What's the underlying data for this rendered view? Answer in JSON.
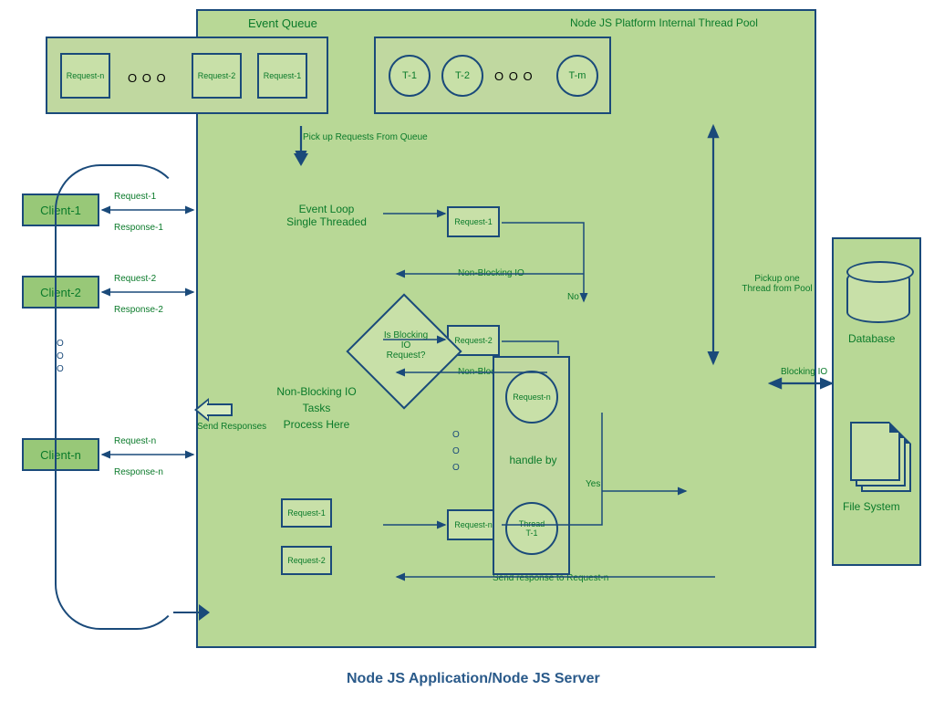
{
  "title": "Node JS Application/Node JS Server",
  "clients": {
    "items": [
      "Client-1",
      "Client-2",
      "Client-n"
    ],
    "requests": [
      "Request-1",
      "Request-2",
      "Request-n"
    ],
    "responses": [
      "Response-1",
      "Response-2",
      "Response-n"
    ]
  },
  "event_queue": {
    "title": "Event Queue",
    "slots": [
      "Request-n",
      "Request-2",
      "Request-1"
    ],
    "ellipsis": "O O O",
    "pickup_label": "Pick up Requests From Queue"
  },
  "thread_pool": {
    "title": "Node JS Platform Internal Thread Pool",
    "threads": [
      "T-1",
      "T-2",
      "T-m"
    ],
    "ellipsis": "O O O",
    "pickup_label": "Pickup one Thread from Pool"
  },
  "event_loop": {
    "title_line1": "Event Loop",
    "title_line2": "Single Threaded",
    "nb_title_line1": "Non-Blocking IO",
    "nb_title_line2": "Tasks",
    "nb_title_line3": "Process Here",
    "inner_requests": [
      "Request-1",
      "Request-2"
    ]
  },
  "flow": {
    "req_boxes": [
      "Request-1",
      "Request-2",
      "Request-n"
    ],
    "non_blocking_label": "Non-Blocking IO",
    "no_label": "No",
    "yes_label": "Yes",
    "send_response_label": "Send response to Request-n",
    "send_responses_label": "Send Responses"
  },
  "diamond": {
    "line1": "Is Blocking",
    "line2": "IO",
    "line3": "Request?"
  },
  "handler": {
    "req_label": "Request-n",
    "handle_by": "handle by",
    "thread_label_line1": "Thread",
    "thread_label_line2": "T-1"
  },
  "external": {
    "database": "Database",
    "filesystem": "File System",
    "blocking_io": "Blocking IO"
  }
}
